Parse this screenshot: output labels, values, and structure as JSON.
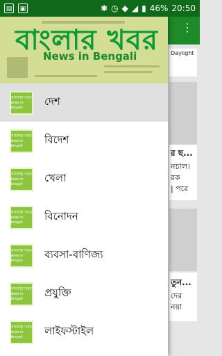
{
  "status_bar": {
    "left_icons": [
      "notification-icon",
      "image-icon"
    ],
    "battery": "46%",
    "time": "20:50"
  },
  "drawer": {
    "header": {
      "title_bn": "বাংলার খবর",
      "title_en": "News in Bengali"
    },
    "icon_text": {
      "bn": "বাংলার খবর",
      "en": "News in Bengali"
    },
    "items": [
      {
        "label": "দেশ"
      },
      {
        "label": "বিদেশ"
      },
      {
        "label": "খেলা"
      },
      {
        "label": "বিনোদন"
      },
      {
        "label": "ব্যবসা-বাণিজ্য"
      },
      {
        "label": "প্রযুক্তি"
      },
      {
        "label": "লাইফস্টাইল"
      }
    ]
  },
  "background": {
    "header_snippet": "Daylight",
    "card1_lines": [
      "র ছ...",
      "নচাল।",
      "রক",
      "| পরে"
    ],
    "card2_lines": [
      "তুন...",
      "দের",
      "নয়া"
    ]
  }
}
